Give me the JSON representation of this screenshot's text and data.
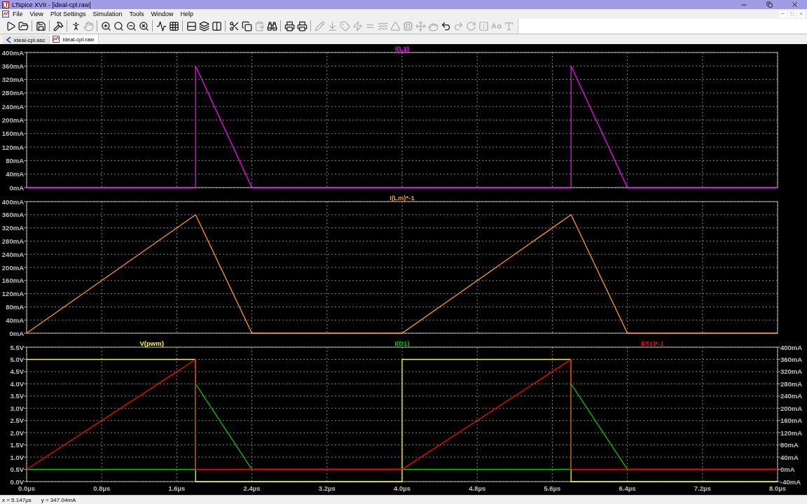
{
  "window": {
    "title": "LTspice XVII - [ideal-cpl.raw]"
  },
  "menu": [
    "File",
    "View",
    "Plot Settings",
    "Simulation",
    "Tools",
    "Window",
    "Help"
  ],
  "toolbar": [
    {
      "kind": "run",
      "disabled": false
    },
    {
      "kind": "open",
      "disabled": false
    },
    {
      "kind": "separator"
    },
    {
      "kind": "save",
      "disabled": false
    },
    {
      "kind": "separator"
    },
    {
      "kind": "control-panel",
      "disabled": false
    },
    {
      "kind": "separator"
    },
    {
      "kind": "probe",
      "disabled": false
    },
    {
      "kind": "pan",
      "disabled": true
    },
    {
      "kind": "separator"
    },
    {
      "kind": "zoom-in",
      "disabled": false
    },
    {
      "kind": "zoom-fit",
      "disabled": false
    },
    {
      "kind": "zoom-out",
      "disabled": false
    },
    {
      "kind": "zoom-cancel",
      "disabled": false
    },
    {
      "kind": "separator"
    },
    {
      "kind": "autorange",
      "disabled": false
    },
    {
      "kind": "grid",
      "disabled": false
    },
    {
      "kind": "separator"
    },
    {
      "kind": "tile-horizontal",
      "disabled": false
    },
    {
      "kind": "cascade",
      "disabled": false
    },
    {
      "kind": "tile-vertical",
      "disabled": false
    },
    {
      "kind": "separator"
    },
    {
      "kind": "cut",
      "disabled": false
    },
    {
      "kind": "copy",
      "disabled": false
    },
    {
      "kind": "paste",
      "disabled": true
    },
    {
      "kind": "find",
      "disabled": false
    },
    {
      "kind": "separator"
    },
    {
      "kind": "print",
      "disabled": false
    },
    {
      "kind": "print-setup",
      "disabled": false
    },
    {
      "kind": "separator"
    },
    {
      "kind": "wire",
      "disabled": true
    },
    {
      "kind": "ground",
      "disabled": true
    },
    {
      "kind": "label",
      "disabled": true
    },
    {
      "kind": "resistor",
      "disabled": true
    },
    {
      "kind": "capacitor",
      "disabled": true
    },
    {
      "kind": "inductor",
      "disabled": true
    },
    {
      "kind": "diode",
      "disabled": true
    },
    {
      "kind": "component",
      "disabled": true
    },
    {
      "kind": "move",
      "disabled": true
    },
    {
      "kind": "drag",
      "disabled": true
    },
    {
      "kind": "undo",
      "disabled": false
    },
    {
      "kind": "redo",
      "disabled": true
    },
    {
      "kind": "rotate",
      "disabled": true
    },
    {
      "kind": "mirror",
      "disabled": true
    },
    {
      "kind": "text",
      "disabled": true
    },
    {
      "kind": "directive",
      "disabled": true
    }
  ],
  "tabs": [
    {
      "label": "ideal-cpl.asc",
      "kind": "schematic",
      "selected": false
    },
    {
      "label": "ideal-cpl.raw",
      "kind": "waveform",
      "selected": true
    }
  ],
  "plots": [
    {
      "chart_data": {
        "type": "line",
        "grid": true,
        "x": [
          0,
          0,
          1.8,
          1.8,
          2.4,
          4.0,
          4.0,
          5.8,
          5.8,
          6.4,
          8.0
        ],
        "xlim": [
          0,
          8
        ],
        "ylim": [
          0,
          400
        ],
        "yticks": [
          {
            "value": 0,
            "label": "0mA"
          },
          {
            "value": 40,
            "label": "40mA"
          },
          {
            "value": 80,
            "label": "80mA"
          },
          {
            "value": 120,
            "label": "120mA"
          },
          {
            "value": 160,
            "label": "160mA"
          },
          {
            "value": 200,
            "label": "200mA"
          },
          {
            "value": 240,
            "label": "240mA"
          },
          {
            "value": 280,
            "label": "280mA"
          },
          {
            "value": 320,
            "label": "320mA"
          },
          {
            "value": 360,
            "label": "360mA"
          },
          {
            "value": 400,
            "label": "400mA"
          }
        ],
        "series": [
          {
            "name": "I(L1)",
            "color": "#ff00ff",
            "values": [
              0,
              0,
              0,
              360,
              0,
              0,
              0,
              0,
              360,
              0,
              0
            ]
          }
        ]
      }
    },
    {
      "chart_data": {
        "type": "line",
        "grid": true,
        "x": [
          0,
          0,
          1.8,
          1.8,
          2.4,
          4.0,
          4.0,
          5.8,
          5.8,
          6.4,
          8.0
        ],
        "xlim": [
          0,
          8
        ],
        "ylim": [
          0,
          400
        ],
        "yticks": [
          {
            "value": 0,
            "label": "0mA"
          },
          {
            "value": 40,
            "label": "40mA"
          },
          {
            "value": 80,
            "label": "80mA"
          },
          {
            "value": 120,
            "label": "120mA"
          },
          {
            "value": 160,
            "label": "160mA"
          },
          {
            "value": 200,
            "label": "200mA"
          },
          {
            "value": 240,
            "label": "240mA"
          },
          {
            "value": 280,
            "label": "280mA"
          },
          {
            "value": 320,
            "label": "320mA"
          },
          {
            "value": 360,
            "label": "360mA"
          },
          {
            "value": 400,
            "label": "400mA"
          }
        ],
        "series": [
          {
            "name": "I(Lm)*-1",
            "color": "#ff9c00",
            "values": [
              0,
              0,
              360,
              360,
              0,
              0,
              0,
              360,
              360,
              0,
              0
            ]
          }
        ]
      }
    },
    {
      "chart_data": {
        "type": "line",
        "grid": true,
        "x": [
          0,
          0,
          1.8,
          1.8,
          2.4,
          4.0,
          4.0,
          5.8,
          5.8,
          6.4,
          8.0
        ],
        "xlim": [
          0,
          8
        ],
        "ylim": [
          0,
          5.5
        ],
        "y2lim": [
          -40,
          400
        ],
        "xticks": [
          {
            "value": 0,
            "label": "0.0µs"
          },
          {
            "value": 0.8,
            "label": "0.8µs"
          },
          {
            "value": 1.6,
            "label": "1.6µs"
          },
          {
            "value": 2.4,
            "label": "2.4µs"
          },
          {
            "value": 3.2,
            "label": "3.2µs"
          },
          {
            "value": 4.0,
            "label": "4.0µs"
          },
          {
            "value": 4.8,
            "label": "4.8µs"
          },
          {
            "value": 5.6,
            "label": "5.6µs"
          },
          {
            "value": 6.4,
            "label": "6.4µs"
          },
          {
            "value": 7.2,
            "label": "7.2µs"
          },
          {
            "value": 8.0,
            "label": "8.0µs"
          }
        ],
        "yticks": [
          {
            "value": 0,
            "label": "0.0V"
          },
          {
            "value": 0.5,
            "label": "0.5V"
          },
          {
            "value": 1.0,
            "label": "1.0V"
          },
          {
            "value": 1.5,
            "label": "1.5V"
          },
          {
            "value": 2.0,
            "label": "2.0V"
          },
          {
            "value": 2.5,
            "label": "2.5V"
          },
          {
            "value": 3.0,
            "label": "3.0V"
          },
          {
            "value": 3.5,
            "label": "3.5V"
          },
          {
            "value": 4.0,
            "label": "4.0V"
          },
          {
            "value": 4.5,
            "label": "4.5V"
          },
          {
            "value": 5.0,
            "label": "5.0V"
          },
          {
            "value": 5.5,
            "label": "5.5V"
          }
        ],
        "y2ticks": [
          {
            "value": -40,
            "label": "-40mA"
          },
          {
            "value": 0,
            "label": "0mA"
          },
          {
            "value": 40,
            "label": "40mA"
          },
          {
            "value": 80,
            "label": "80mA"
          },
          {
            "value": 120,
            "label": "120mA"
          },
          {
            "value": 160,
            "label": "160mA"
          },
          {
            "value": 200,
            "label": "200mA"
          },
          {
            "value": 240,
            "label": "240mA"
          },
          {
            "value": 280,
            "label": "280mA"
          },
          {
            "value": 320,
            "label": "320mA"
          },
          {
            "value": 360,
            "label": "360mA"
          },
          {
            "value": 400,
            "label": "400mA"
          }
        ],
        "series": [
          {
            "name": "V(pwm)",
            "color": "#ffff00",
            "values": [
              null,
              5,
              5,
              0,
              0,
              0,
              5,
              5,
              0,
              0,
              0
            ]
          },
          {
            "name": "I(D1)",
            "color": "#00c800",
            "axis": "y2",
            "values": [
              0,
              0,
              0,
              280,
              0,
              0,
              0,
              0,
              280,
              0,
              0
            ]
          },
          {
            "name": "I(S1)*-1",
            "color": "#ff0000",
            "axis": "y2",
            "values": [
              0,
              0,
              360,
              0,
              0,
              0,
              0,
              360,
              0,
              0,
              0
            ]
          }
        ]
      }
    }
  ],
  "status_bar": {
    "x_reading": "x = 5.147µs",
    "y_reading": "y = 347.04mA"
  }
}
